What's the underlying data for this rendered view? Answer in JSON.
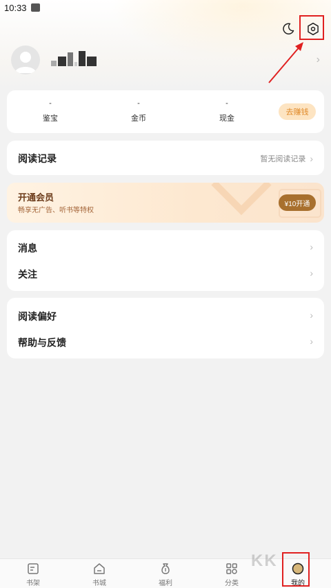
{
  "status_bar": {
    "time": "10:33"
  },
  "header": {
    "theme_icon": "moon-icon",
    "settings_icon": "gear-icon"
  },
  "stats": {
    "items": [
      {
        "label": "鉴宝",
        "value": "-"
      },
      {
        "label": "金币",
        "value": "-"
      },
      {
        "label": "现金",
        "value": "-"
      }
    ],
    "earn_button": "去赚钱"
  },
  "reading_history": {
    "title": "阅读记录",
    "status": "暂无阅读记录"
  },
  "vip": {
    "title": "开通会员",
    "subtitle": "畅享无广告、听书等特权",
    "button": "¥10开通"
  },
  "menu_group_1": {
    "items": [
      {
        "label": "消息"
      },
      {
        "label": "关注"
      }
    ]
  },
  "menu_group_2": {
    "items": [
      {
        "label": "阅读偏好"
      },
      {
        "label": "帮助与反馈"
      }
    ]
  },
  "tabbar": {
    "tabs": [
      {
        "label": "书架",
        "icon": "bookshelf-icon"
      },
      {
        "label": "书城",
        "icon": "home-icon"
      },
      {
        "label": "福利",
        "icon": "money-bag-icon"
      },
      {
        "label": "分类",
        "icon": "category-icon"
      },
      {
        "label": "我的",
        "icon": "profile-icon"
      }
    ],
    "active": "我的"
  },
  "colors": {
    "highlight": "#e02020",
    "accent": "#e08a2a",
    "vip_button": "#a8702e"
  }
}
